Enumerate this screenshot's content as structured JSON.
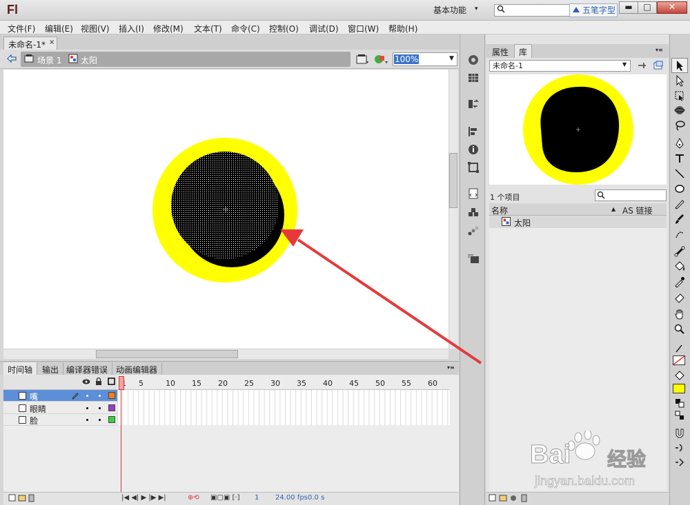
{
  "app": {
    "logo": "Fl",
    "workspace": "基本功能",
    "ime_label": "五笔字型",
    "window_buttons": {
      "minimize": "▬",
      "maximize": "□",
      "close": "✕"
    }
  },
  "menu": [
    "文件(F)",
    "编辑(E)",
    "视图(V)",
    "插入(I)",
    "修改(M)",
    "文本(T)",
    "命令(C)",
    "控制(O)",
    "调试(D)",
    "窗口(W)",
    "帮助(H)"
  ],
  "document": {
    "tab_label": "未命名-1*",
    "tab_close": "×",
    "scene_label": "场景 1",
    "symbol_label": "太阳",
    "zoom": "100%"
  },
  "stage": {
    "outer_color": "#ffff00",
    "inner_color": "#000000",
    "arrow_color": "#e63a3a"
  },
  "timeline": {
    "tabs": [
      "时间轴",
      "输出",
      "编译器错误",
      "动画编辑器"
    ],
    "ruler": [
      "1",
      "5",
      "10",
      "15",
      "20",
      "25",
      "30",
      "35",
      "40",
      "45",
      "50",
      "55",
      "60"
    ],
    "layers": [
      {
        "name": "嘴",
        "color": "#ff7b1a",
        "selected": true
      },
      {
        "name": "眼睛",
        "color": "#9b3cc8",
        "selected": false
      },
      {
        "name": "脸",
        "color": "#39d23a",
        "selected": false
      }
    ],
    "current_frame": "1",
    "fps": "24.00 fps",
    "time": "0.0 s"
  },
  "library": {
    "tabs": [
      "属性",
      "库"
    ],
    "document": "未命名-1",
    "item_count": "1 个项目",
    "col_name": "名称",
    "col_linkage": "AS 链接",
    "items": [
      "太阳"
    ]
  },
  "watermark": {
    "brand": "Bai",
    "brand_cn": "经验",
    "url": "jingyan.baidu.com"
  }
}
